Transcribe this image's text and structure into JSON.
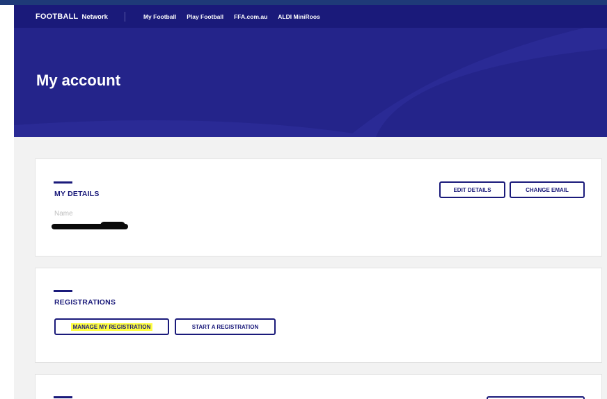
{
  "nav": {
    "logo_main": "FOOTBALL",
    "logo_sub": "Network",
    "links": [
      "My Football",
      "Play Football",
      "FFA.com.au",
      "ALDI MiniRoos"
    ]
  },
  "hero": {
    "title": "My account"
  },
  "details": {
    "heading": "MY DETAILS",
    "edit_label": "EDIT DETAILS",
    "change_email_label": "CHANGE EMAIL",
    "name_label": "Name"
  },
  "registrations": {
    "heading": "REGISTRATIONS",
    "manage_label": "MANAGE MY REGISTRATION",
    "start_label": "START A REGISTRATION"
  },
  "colors": {
    "brand_navy": "#1a1a7a",
    "hero_blue": "#24248a",
    "highlight": "#ffff40",
    "page_bg": "#f2f2f2"
  }
}
